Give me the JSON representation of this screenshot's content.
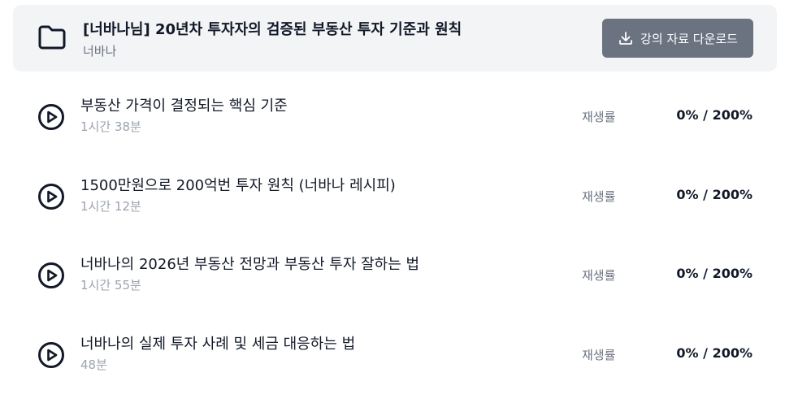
{
  "course": {
    "title": "[너바나님] 20년차 투자자의 검증된 부동산 투자 기준과 원칙",
    "author": "너바나",
    "download_label": "강의 자료 다운로드",
    "folder_icon": "folder-icon",
    "download_icon": "download-icon"
  },
  "lectures": [
    {
      "title": "부동산 가격이 결정되는 핵심 기준",
      "duration": "1시간 38분",
      "progress_label": "재생률",
      "progress_value": "0% / 200%",
      "icon": "play-circle-icon"
    },
    {
      "title": "1500만원으로 200억번 투자 원칙 (너바나 레시피)",
      "duration": "1시간 12분",
      "progress_label": "재생률",
      "progress_value": "0% / 200%",
      "icon": "play-circle-icon"
    },
    {
      "title": "너바나의 2026년 부동산 전망과 부동산 투자 잘하는 법",
      "duration": "1시간 55분",
      "progress_label": "재생률",
      "progress_value": "0% / 200%",
      "icon": "play-circle-icon"
    },
    {
      "title": "너바나의 실제 투자 사례 및 세금 대응하는 법",
      "duration": "48분",
      "progress_label": "재생률",
      "progress_value": "0% / 200%",
      "icon": "play-circle-icon"
    }
  ],
  "colors": {
    "header_bg": "#f3f4f6",
    "button_bg": "#6b7280",
    "text_primary": "#111827",
    "text_secondary": "#9ca3af"
  }
}
